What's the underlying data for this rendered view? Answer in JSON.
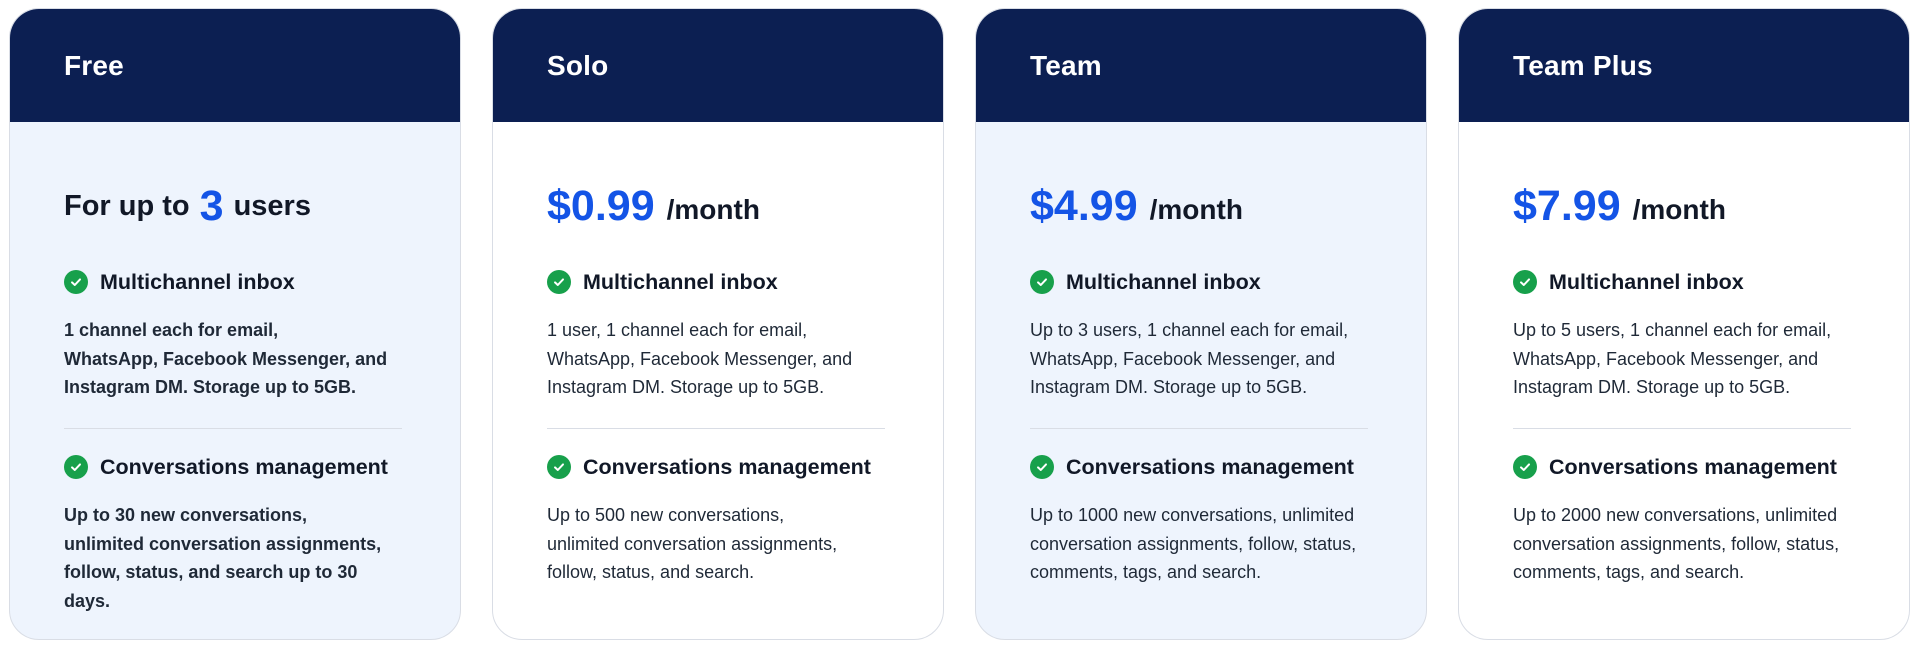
{
  "plans": [
    {
      "name": "Free",
      "users_prefix": "For up to",
      "users_count": "3",
      "users_suffix": "users",
      "features": [
        {
          "title": "Multichannel inbox",
          "description": "1 channel each for email,\nWhatsApp, Facebook Messenger, and\nInstagram DM. Storage up to 5GB."
        },
        {
          "title": "Conversations management",
          "description": "Up to 30 new conversations,\nunlimited conversation assignments,\nfollow, status, and search up to 30 days."
        }
      ]
    },
    {
      "name": "Solo",
      "price": "$0.99",
      "period": "/month",
      "features": [
        {
          "title": "Multichannel inbox",
          "description": "1 user, 1 channel each for email,\nWhatsApp, Facebook Messenger, and\nInstagram DM. Storage up to 5GB."
        },
        {
          "title": "Conversations management",
          "description": "Up to 500 new conversations,\nunlimited conversation assignments,\nfollow, status, and search."
        }
      ]
    },
    {
      "name": "Team",
      "price": "$4.99",
      "period": "/month",
      "features": [
        {
          "title": "Multichannel inbox",
          "description": "Up to 3 users, 1 channel each for email,\nWhatsApp, Facebook Messenger, and\nInstagram DM. Storage up to 5GB."
        },
        {
          "title": "Conversations management",
          "description": "Up to 1000 new conversations, unlimited\nconversation assignments, follow, status,\ncomments, tags, and search."
        }
      ]
    },
    {
      "name": "Team Plus",
      "price": "$7.99",
      "period": "/month",
      "features": [
        {
          "title": "Multichannel inbox",
          "description": "Up to 5 users, 1 channel each for email,\nWhatsApp, Facebook Messenger, and\nInstagram DM. Storage up to 5GB."
        },
        {
          "title": "Conversations management",
          "description": "Up to 2000 new conversations, unlimited\nconversation assignments, follow, status,\ncomments, tags, and search."
        }
      ]
    }
  ],
  "colors": {
    "header_bg": "#0c1f52",
    "accent_blue": "#1454e6",
    "check_green": "#17a04b",
    "tinted_card_bg": "#eef4fd"
  }
}
